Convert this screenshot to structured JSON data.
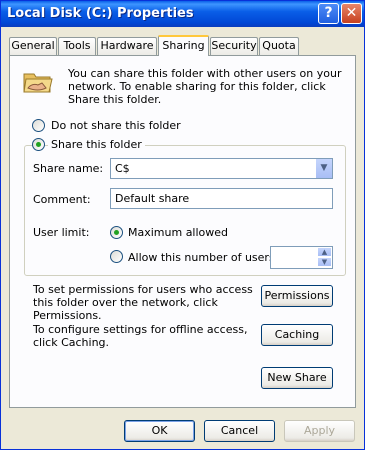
{
  "window": {
    "title": "Local Disk (C:) Properties",
    "help_glyph": "?",
    "close_glyph": "✕"
  },
  "tabs": [
    "General",
    "Tools",
    "Hardware",
    "Sharing",
    "Security",
    "Quota"
  ],
  "sharing": {
    "intro": "You can share this folder with other users on your network.  To enable sharing for this folder, click Share this folder.",
    "do_not_share_label": "Do not share this folder",
    "share_label": "Share this folder",
    "share_name_label": "Share name:",
    "share_name_value": "C$",
    "comment_label": "Comment:",
    "comment_value": "Default share",
    "user_limit_label": "User limit:",
    "max_allowed_label": "Maximum allowed",
    "allow_number_label": "Allow this number of users:",
    "allow_number_value": "",
    "permissions_text": "To set permissions for users who access this folder over the network, click Permissions.",
    "permissions_button": "Permissions",
    "caching_text": "To configure settings for offline access, click Caching.",
    "caching_button": "Caching",
    "new_share_button": "New Share"
  },
  "footer": {
    "ok": "OK",
    "cancel": "Cancel",
    "apply": "Apply"
  },
  "icons": {
    "folder": "shared-folder-icon",
    "combo": "chevron-down-icon",
    "spin_up": "spin-up-icon",
    "spin_down": "spin-down-icon"
  },
  "colors": {
    "titlebar": "#0A5FE8",
    "face": "#ECE9D8",
    "tab_highlight": "#FFC83C",
    "radio_dot": "#21A121"
  }
}
